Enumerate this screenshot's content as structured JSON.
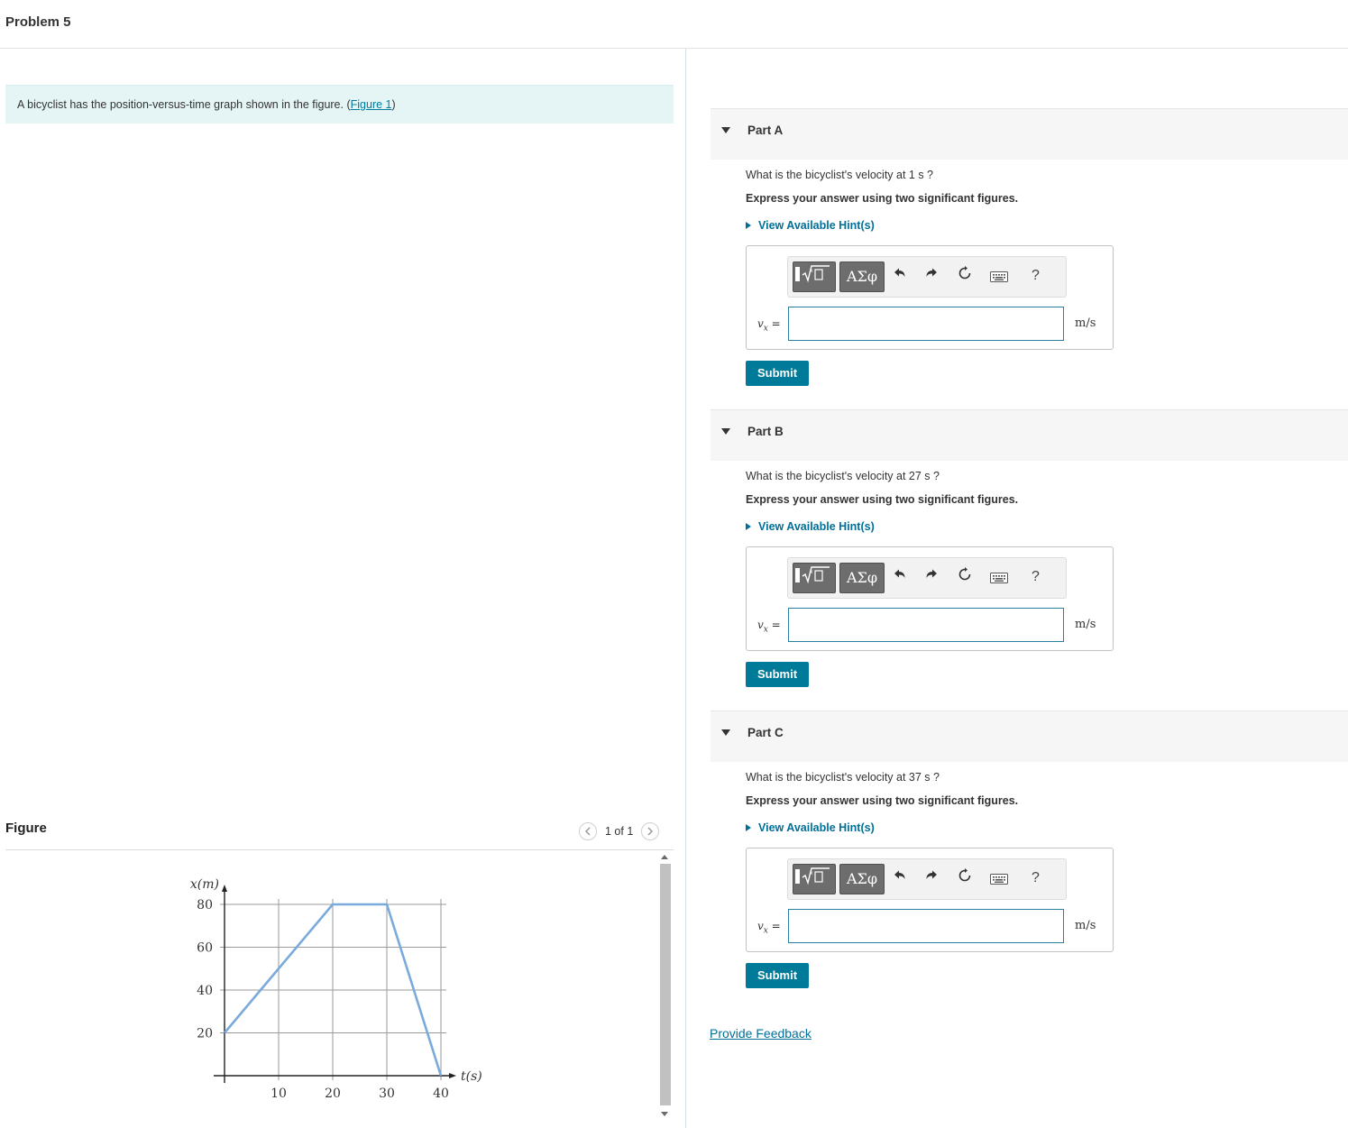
{
  "header": {
    "title": "Problem 5"
  },
  "intro": {
    "text": "A bicyclist has the position-versus-time graph shown in the figure. (",
    "link": "Figure 1",
    "tail": ")"
  },
  "figure": {
    "title": "Figure",
    "pager": "1 of 1"
  },
  "chart_data": {
    "type": "line",
    "x": [
      0,
      20,
      30,
      40
    ],
    "y": [
      20,
      80,
      80,
      0
    ],
    "xlabel": "t(s)",
    "ylabel": "x(m)",
    "xticks": [
      "10",
      "20",
      "30",
      "40"
    ],
    "yticks": [
      "20",
      "40",
      "60",
      "80"
    ],
    "xlim": [
      0,
      40
    ],
    "ylim": [
      0,
      80
    ],
    "grid": true,
    "line_color": "#7aaadc"
  },
  "parts": [
    {
      "label": "Part A",
      "question": "What is the bicyclist's velocity at 1 s ?",
      "instruction": "Express your answer using two significant figures.",
      "hint": "View Available Hint(s)",
      "variable": "v",
      "subscript": "x",
      "equals": " =",
      "unit": "m/s",
      "greek": "ΑΣφ",
      "help": "?",
      "submit": "Submit"
    },
    {
      "label": "Part B",
      "question": "What is the bicyclist's velocity at 27 s ?",
      "instruction": "Express your answer using two significant figures.",
      "hint": "View Available Hint(s)",
      "variable": "v",
      "subscript": "x",
      "equals": " =",
      "unit": "m/s",
      "greek": "ΑΣφ",
      "help": "?",
      "submit": "Submit"
    },
    {
      "label": "Part C",
      "question": "What is the bicyclist's velocity at 37 s ?",
      "instruction": "Express your answer using two significant figures.",
      "hint": "View Available Hint(s)",
      "variable": "v",
      "subscript": "x",
      "equals": " =",
      "unit": "m/s",
      "greek": "ΑΣφ",
      "help": "?",
      "submit": "Submit"
    }
  ],
  "feedback": "Provide Feedback",
  "colors": {
    "accent": "#007a99",
    "intro_bg": "#e5f5f6",
    "link": "#006f99"
  }
}
